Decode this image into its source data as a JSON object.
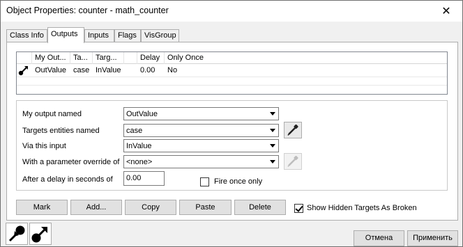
{
  "window": {
    "title": "Object Properties: counter - math_counter",
    "close_glyph": "✕"
  },
  "tabs": [
    {
      "label": "Class Info"
    },
    {
      "label": "Outputs"
    },
    {
      "label": "Inputs"
    },
    {
      "label": "Flags"
    },
    {
      "label": "VisGroup"
    }
  ],
  "outputs_list": {
    "columns": [
      "My Out...",
      "Ta...",
      "Targ...",
      "",
      "Delay",
      "Only Once"
    ],
    "rows": [
      {
        "output": "OutValue",
        "target": "case",
        "input": "InValue",
        "delay": "0.00",
        "only_once": "No"
      }
    ]
  },
  "form": {
    "output_label": "My output named",
    "output_value": "OutValue",
    "targets_label": "Targets entities named",
    "targets_value": "case",
    "input_label": "Via this input",
    "input_value": "InValue",
    "param_label": "With a parameter override of",
    "param_value": "<none>",
    "delay_label": "After a delay in seconds of",
    "delay_value": "0.00",
    "fire_once_label": "Fire once only",
    "fire_once_checked": false
  },
  "buttons": {
    "mark": "Mark",
    "add": "Add...",
    "copy": "Copy",
    "paste": "Paste",
    "delete": "Delete"
  },
  "show_hidden": {
    "label": "Show Hidden Targets As Broken",
    "checked": true
  },
  "footer": {
    "cancel": "Отмена",
    "apply": "Применить"
  },
  "icons": {
    "row_icon": "output-connection-icon",
    "target_picker": "eyedropper-icon",
    "param_picker": "eyedropper-icon",
    "bottom_left_1": "input-connection-icon",
    "bottom_left_2": "output-connection-icon"
  }
}
